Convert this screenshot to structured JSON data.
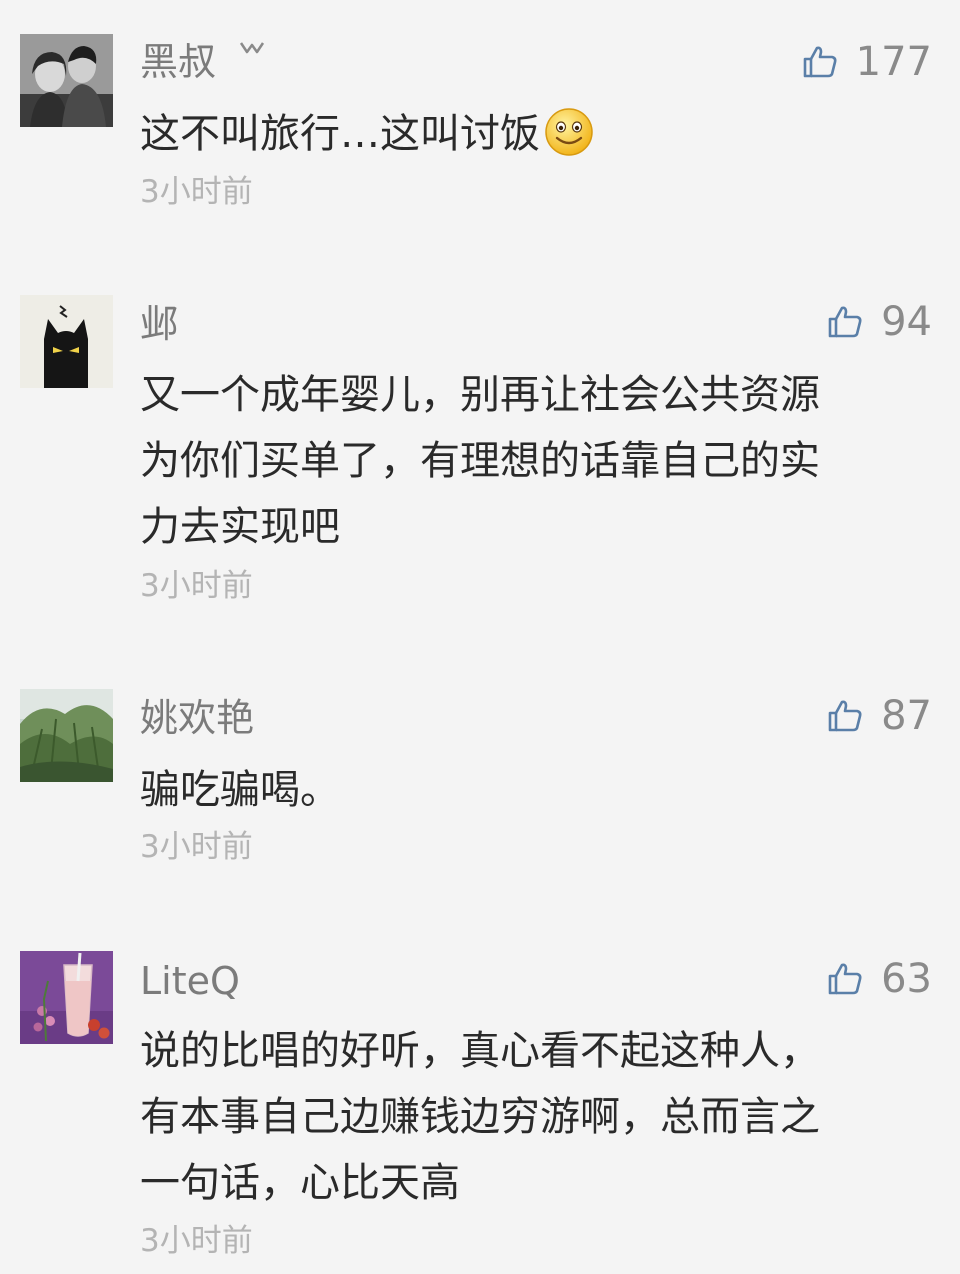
{
  "comments": [
    {
      "username": "黑叔",
      "likes": "177",
      "lines": [
        "这不叫旅行…这叫讨饭"
      ],
      "has_emoji": true,
      "time": "3小时前"
    },
    {
      "username": "邺",
      "likes": "94",
      "lines": [
        "又一个成年婴儿，别再让社会公共资源",
        "为你们买单了，有理想的话靠自己的实",
        "力去实现吧"
      ],
      "time": "3小时前"
    },
    {
      "username": "姚欢艳",
      "likes": "87",
      "lines": [
        "骗吃骗喝。"
      ],
      "time": "3小时前"
    },
    {
      "username": "LiteQ",
      "likes": "63",
      "lines": [
        "说的比唱的好听，真心看不起这种人，",
        "有本事自己边赚钱边穷游啊，总而言之",
        "一句话，心比天高"
      ],
      "time": "3小时前"
    }
  ],
  "icons": {
    "like": "thumbs-up-icon",
    "badge": "crown-badge-icon",
    "emoji": "smile-emoji-icon"
  },
  "colors": {
    "background": "#f4f4f4",
    "username": "#7b7b7b",
    "text": "#2a2a2a",
    "time": "#b4b4b4",
    "like_icon": "#5a7fa8"
  }
}
